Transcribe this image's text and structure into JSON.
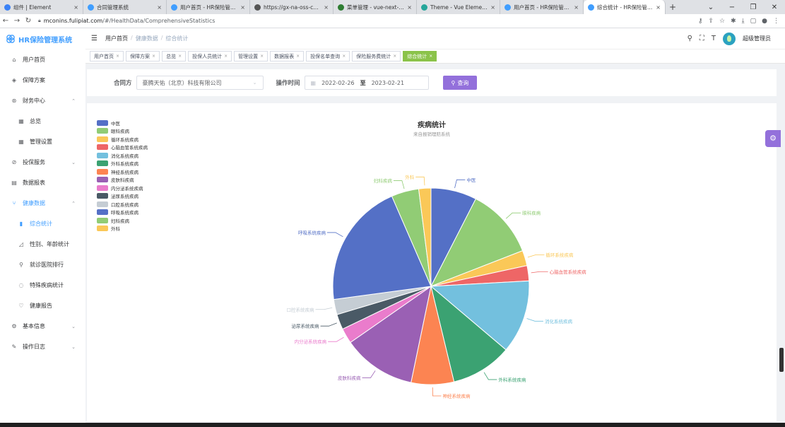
{
  "browser": {
    "tabs": [
      {
        "title": "组件 | Element",
        "fav": "#3b82f6",
        "active": false
      },
      {
        "title": "合同管理系统",
        "fav": "#409eff",
        "active": false
      },
      {
        "title": "用户首页 - HR保险管理系",
        "fav": "#409eff",
        "active": false
      },
      {
        "title": "https://gx-na-oss-cn-zh",
        "fav": "#555555",
        "active": false
      },
      {
        "title": "菜单管理 - vue-next-adm",
        "fav": "#2e7d32",
        "active": false
      },
      {
        "title": "Theme - Vue Element A",
        "fav": "#26a69a",
        "active": false
      },
      {
        "title": "用户首页 - HR保险管理系",
        "fav": "#409eff",
        "active": false
      },
      {
        "title": "综合统计 - HR保险管理系",
        "fav": "#409eff",
        "active": true
      }
    ],
    "url_host": "mconins.fulipiat.com",
    "url_path": "/#/HealthData/ComprehensiveStatistics"
  },
  "app": {
    "logo_text": "HR保险管理系统",
    "user_name": "超级管理员",
    "breadcrumb": [
      "用户首页",
      "健康数据",
      "综合统计"
    ]
  },
  "sidebar": {
    "items": [
      {
        "label": "用户首页",
        "icon": "home-icon",
        "glyph": "⌂",
        "level": 0,
        "arrow": false,
        "state": ""
      },
      {
        "label": "保障方案",
        "icon": "shield-icon",
        "glyph": "◈",
        "level": 0,
        "arrow": false,
        "state": ""
      },
      {
        "label": "财务中心",
        "icon": "finance-icon",
        "glyph": "⊛",
        "level": 0,
        "arrow": true,
        "arrow_glyph": "⌃",
        "state": ""
      },
      {
        "label": "总览",
        "icon": "grid-icon",
        "glyph": "▦",
        "level": 1,
        "arrow": false,
        "state": ""
      },
      {
        "label": "管理设置",
        "icon": "grid-icon",
        "glyph": "▦",
        "level": 1,
        "arrow": false,
        "state": ""
      },
      {
        "label": "投保服务",
        "icon": "service-icon",
        "glyph": "⊘",
        "level": 0,
        "arrow": true,
        "arrow_glyph": "⌄",
        "state": ""
      },
      {
        "label": "数据报表",
        "icon": "report-icon",
        "glyph": "▤",
        "level": 0,
        "arrow": false,
        "state": ""
      },
      {
        "label": "健康数据",
        "icon": "health-icon",
        "glyph": "⑂",
        "level": 0,
        "arrow": true,
        "arrow_glyph": "⌃",
        "state": "active-parent"
      },
      {
        "label": "综合统计",
        "icon": "bar-chart-icon",
        "glyph": "▮",
        "level": 1,
        "arrow": false,
        "state": "selected"
      },
      {
        "label": "性别、年龄统计",
        "icon": "analytics-icon",
        "glyph": "◿",
        "level": 1,
        "arrow": false,
        "state": ""
      },
      {
        "label": "就诊医院排行",
        "icon": "hospital-icon",
        "glyph": "⚲",
        "level": 1,
        "arrow": false,
        "state": ""
      },
      {
        "label": "特殊疾病统计",
        "icon": "disease-icon",
        "glyph": "◌",
        "level": 1,
        "arrow": false,
        "state": ""
      },
      {
        "label": "健康报告",
        "icon": "report-heart-icon",
        "glyph": "♡",
        "level": 1,
        "arrow": false,
        "state": ""
      },
      {
        "label": "基本信息",
        "icon": "info-icon",
        "glyph": "⚙",
        "level": 0,
        "arrow": true,
        "arrow_glyph": "⌄",
        "state": ""
      },
      {
        "label": "操作日志",
        "icon": "log-icon",
        "glyph": "✎",
        "level": 0,
        "arrow": true,
        "arrow_glyph": "⌄",
        "state": ""
      }
    ]
  },
  "tags": [
    {
      "label": "用户首页",
      "active": false
    },
    {
      "label": "保障方案",
      "active": false
    },
    {
      "label": "总览",
      "active": false
    },
    {
      "label": "投保人员统计",
      "active": false
    },
    {
      "label": "管理设置",
      "active": false
    },
    {
      "label": "数据报表",
      "active": false
    },
    {
      "label": "投保名单查询",
      "active": false
    },
    {
      "label": "保险服务费统计",
      "active": false
    },
    {
      "label": "综合统计",
      "active": true
    }
  ],
  "filter": {
    "contract_label": "合同方",
    "contract_value": "豪腾天佑（北京）科技有限公司",
    "time_label": "操作时间",
    "date_start": "2022-02-26",
    "date_sep": "至",
    "date_end": "2023-02-21",
    "query_label": "查询"
  },
  "chart_data": {
    "type": "pie",
    "title": "疾病统计",
    "subtitle": "来自报销理赔系统",
    "legend_position": "top-left",
    "slices": [
      {
        "name": "中医",
        "value": 7.5,
        "color": "#5470c6"
      },
      {
        "name": "眼科疾病",
        "value": 11.5,
        "color": "#91cc75"
      },
      {
        "name": "循环系统疾病",
        "value": 2.5,
        "color": "#fac858"
      },
      {
        "name": "心脑血管系统疾病",
        "value": 2.5,
        "color": "#ee6666"
      },
      {
        "name": "消化系统疾病",
        "value": 12.0,
        "color": "#73c0de"
      },
      {
        "name": "外科系统疾病",
        "value": 10.0,
        "color": "#3ba272"
      },
      {
        "name": "神经系统疾病",
        "value": 7.0,
        "color": "#fc8452"
      },
      {
        "name": "皮肤科疾病",
        "value": 12.0,
        "color": "#9a60b4"
      },
      {
        "name": "内分泌系统疾病",
        "value": 2.5,
        "color": "#ea7ccc"
      },
      {
        "name": "泌尿系统疾病",
        "value": 2.5,
        "color": "#4a5a66"
      },
      {
        "name": "口腔系统疾病",
        "value": 2.5,
        "color": "#c5cdd4"
      },
      {
        "name": "呼吸系统疾病",
        "value": 20.5,
        "color": "#5470c6"
      },
      {
        "name": "妇科疾病",
        "value": 4.5,
        "color": "#91cc75"
      },
      {
        "name": "外科",
        "value": 2.0,
        "color": "#fac858"
      }
    ]
  }
}
